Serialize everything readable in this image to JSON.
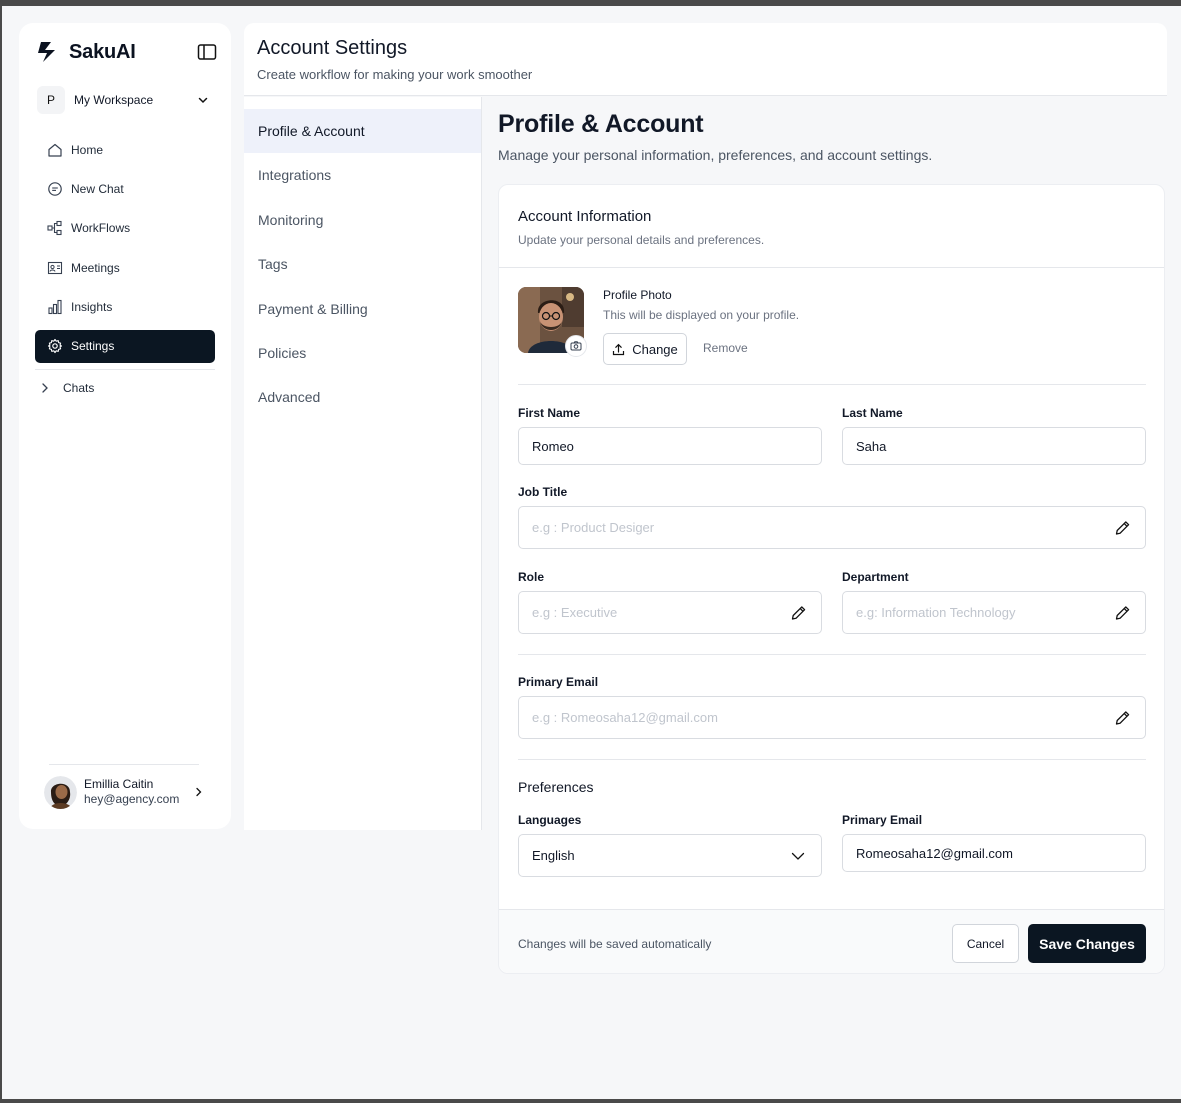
{
  "app": {
    "brand_name": "SakuAI",
    "workspace": {
      "initial": "P",
      "name": "My Workspace"
    }
  },
  "sidebar": {
    "items": [
      {
        "label": "Home",
        "icon": "home-icon"
      },
      {
        "label": "New Chat",
        "icon": "chat-bubble-icon"
      },
      {
        "label": "WorkFlows",
        "icon": "workflow-icon"
      },
      {
        "label": "Meetings",
        "icon": "meetings-icon"
      },
      {
        "label": "Insights",
        "icon": "bar-chart-icon"
      },
      {
        "label": "Settings",
        "icon": "gear-icon",
        "active": true
      }
    ],
    "chats_label": "Chats",
    "user": {
      "name": "Emillia Caitin",
      "email": "hey@agency.com"
    }
  },
  "header": {
    "title": "Account Settings",
    "subtitle": "Create workflow for making your work smoother"
  },
  "settings_menu": {
    "items": [
      {
        "label": "Profile & Account",
        "active": true
      },
      {
        "label": "Integrations"
      },
      {
        "label": "Monitoring"
      },
      {
        "label": "Tags"
      },
      {
        "label": "Payment & Billing"
      },
      {
        "label": "Policies"
      },
      {
        "label": "Advanced"
      }
    ]
  },
  "main": {
    "title": "Profile & Account",
    "subtitle": "Manage your personal information, preferences, and account settings."
  },
  "card": {
    "title": "Account Information",
    "subtitle": "Update your personal details and preferences.",
    "photo": {
      "label": "Profile Photo",
      "subtitle": "This will be displayed on your profile.",
      "change_label": "Change",
      "remove_label": "Remove"
    },
    "fields": {
      "first_name": {
        "label": "First Name",
        "value": "Romeo"
      },
      "last_name": {
        "label": "Last Name",
        "value": "Saha"
      },
      "job_title": {
        "label": "Job Title",
        "placeholder": "e.g : Product Desiger"
      },
      "role": {
        "label": "Role",
        "placeholder": "e.g : Executive"
      },
      "department": {
        "label": "Department",
        "placeholder": "e.g: Information Technology"
      },
      "primary_email": {
        "label": "Primary Email",
        "placeholder": "e.g : Romeosaha12@gmail.com"
      }
    },
    "preferences": {
      "title": "Preferences",
      "language": {
        "label": "Languages",
        "value": "English"
      },
      "primary_email": {
        "label": "Primary Email",
        "value": "Romeosaha12@gmail.com"
      }
    },
    "footer": {
      "note": "Changes will be saved automatically",
      "cancel_label": "Cancel",
      "save_label": "Save Changes"
    }
  },
  "colors": {
    "primary_dark": "#0b1622",
    "active_menu_bg": "#eef1fa",
    "page_bg": "#f6f7f9"
  }
}
